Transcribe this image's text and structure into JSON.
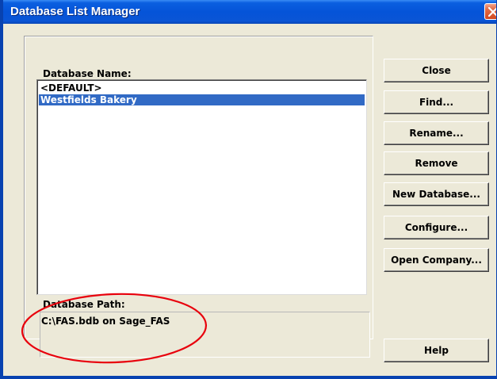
{
  "window": {
    "title": "Database List Manager"
  },
  "labels": {
    "database_name": "Database Name:",
    "database_path": "Database Path:"
  },
  "list": {
    "items": [
      {
        "label": "<DEFAULT>",
        "selected": false
      },
      {
        "label": "Westfields Bakery",
        "selected": true
      }
    ]
  },
  "path": {
    "value": "C:\\FAS.bdb on Sage_FAS"
  },
  "buttons": {
    "close": "Close",
    "find": "Find...",
    "rename": "Rename...",
    "remove": "Remove",
    "new_database": "New Database...",
    "configure": "Configure...",
    "open_company": "Open Company...",
    "help": "Help"
  },
  "colors": {
    "titlebar": "#0554d8",
    "selection": "#316ac5",
    "face": "#ece9d8",
    "annotation": "#e8000c",
    "close_button": "#d2481f"
  },
  "icons": {
    "title_close": "close-icon"
  }
}
